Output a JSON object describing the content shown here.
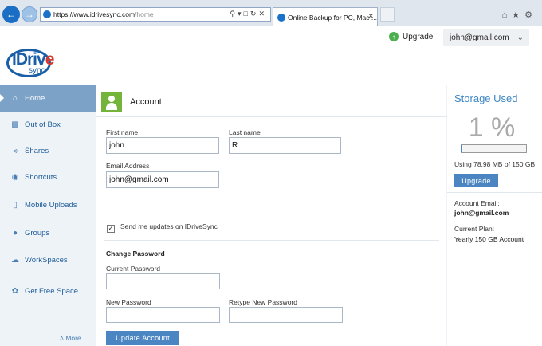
{
  "browser": {
    "url_main": "https://www.idrivesync.com",
    "url_rest": "/home",
    "tab_title": "Online Backup for PC, Mac ..."
  },
  "header": {
    "upgrade_label": "Upgrade",
    "user_email": "john@gmail.com"
  },
  "logo": {
    "main": "IDriv",
    "e": "e",
    "sync": "sync"
  },
  "sidebar": {
    "items": [
      {
        "label": "Home",
        "icon": "home-icon"
      },
      {
        "label": "Out of Box",
        "icon": "box-icon"
      },
      {
        "label": "Shares",
        "icon": "share-icon"
      },
      {
        "label": "Shortcuts",
        "icon": "shortcut-icon"
      },
      {
        "label": "Mobile Uploads",
        "icon": "mobile-icon"
      },
      {
        "label": "Groups",
        "icon": "group-icon"
      },
      {
        "label": "WorkSpaces",
        "icon": "workspace-icon"
      },
      {
        "label": "Get Free Space",
        "icon": "gift-icon"
      }
    ],
    "more_label": "More"
  },
  "account": {
    "title": "Account",
    "first_name_label": "First name",
    "first_name_value": "john",
    "last_name_label": "Last name",
    "last_name_value": "R",
    "email_label": "Email Address",
    "email_value": "john@gmail.com",
    "updates_label": "Send me updates on IDriveSync",
    "change_password_title": "Change Password",
    "current_password_label": "Current Password",
    "new_password_label": "New Password",
    "retype_password_label": "Retype New Password",
    "update_button": "Update Account"
  },
  "storage": {
    "title": "Storage Used",
    "percent": "1 %",
    "used_fraction": 0.01,
    "using_text": "Using 78.98 MB of 150  GB",
    "upgrade_button": "Upgrade",
    "account_email_label": "Account Email:",
    "account_email_value": "john@gmail.com",
    "plan_label": "Current Plan:",
    "plan_value": "Yearly 150 GB Account"
  },
  "colors": {
    "accent": "#4b86c2",
    "sidebar_active": "#7da2c7",
    "account_icon": "#74b43b"
  }
}
